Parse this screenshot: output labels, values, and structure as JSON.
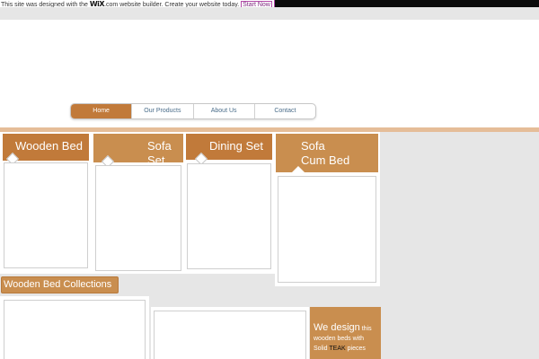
{
  "wix_banner": {
    "text_before": "This site was designed with the",
    "logo": "WiX",
    "domain_suffix": ".com",
    "text_after": "website builder. Create your website today.",
    "link_label": "Start Now"
  },
  "nav": {
    "items": [
      {
        "label": "Home",
        "active": true
      },
      {
        "label": "Our Products",
        "active": false
      },
      {
        "label": "About Us",
        "active": false
      },
      {
        "label": "Contact",
        "active": false
      }
    ]
  },
  "categories": [
    {
      "label": "Wooden Bed"
    },
    {
      "label": "Sofa Set"
    },
    {
      "label": "Dining Set"
    },
    {
      "label": "Sofa Cum Bed"
    }
  ],
  "collections_button": "Wooden Bed Collections",
  "promo": {
    "line1_big": "We design",
    "line1_small": "this",
    "line2": "wooden beds with",
    "line3_prefix": "Solid",
    "line3_teak": "TEAK",
    "line3_suffix": "pieces"
  },
  "colors": {
    "accent_dark": "#c17a3a",
    "accent_light": "#c98e4f",
    "divider": "#e5bd98",
    "page_bg": "#e6e6e6"
  }
}
